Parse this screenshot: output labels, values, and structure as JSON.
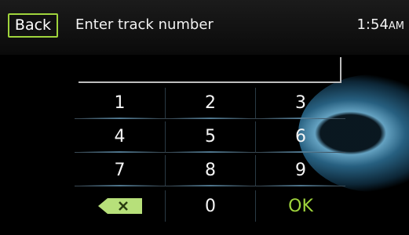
{
  "header": {
    "back_label": "Back",
    "title": "Enter track number",
    "time": "1:54",
    "ampm": "AM"
  },
  "entry": {
    "value": ""
  },
  "keypad": {
    "keys": [
      "1",
      "2",
      "3",
      "4",
      "5",
      "6",
      "7",
      "8",
      "9"
    ],
    "zero": "0",
    "ok_label": "OK",
    "backspace_icon": "backspace-icon"
  },
  "colors": {
    "accent": "#9fd43c",
    "background": "#000000",
    "text": "#f2f2f2"
  }
}
